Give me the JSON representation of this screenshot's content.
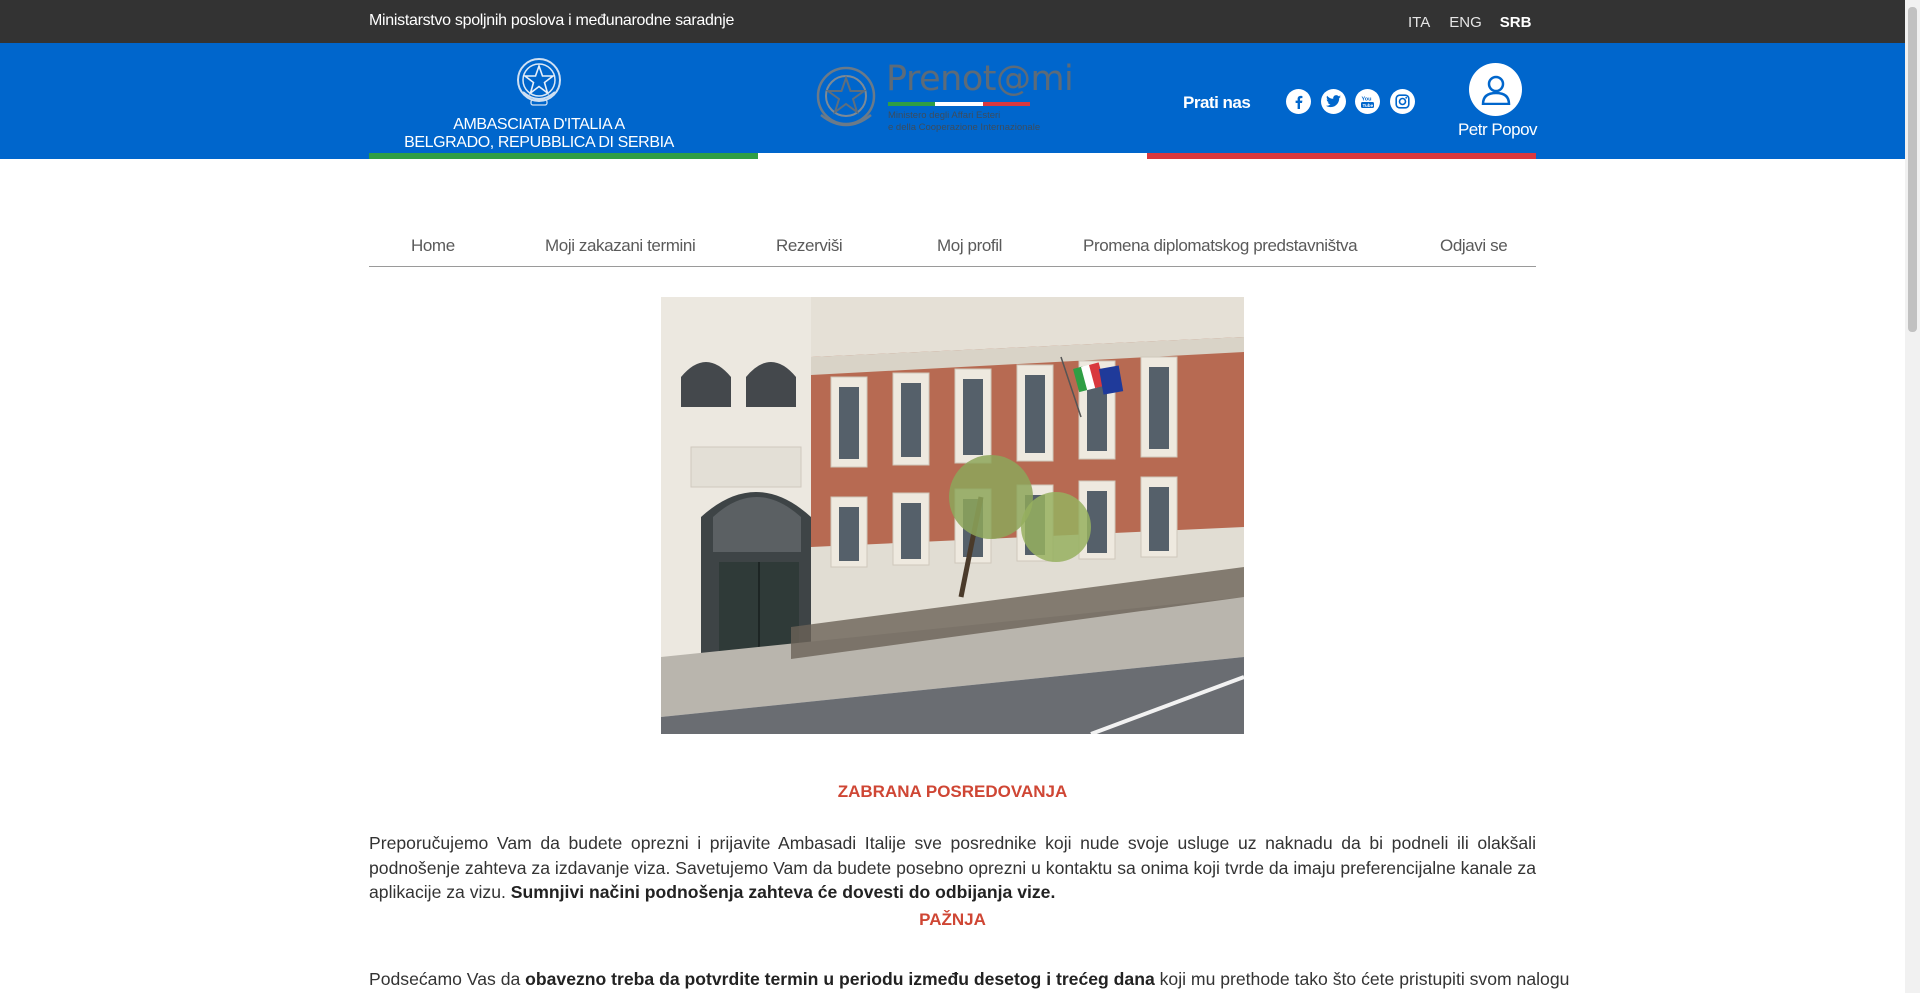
{
  "topbar": {
    "ministry": "Ministarstvo spoljnih poslova i međunarodne saradnje",
    "languages": [
      {
        "label": "ITA",
        "active": false
      },
      {
        "label": "ENG",
        "active": false
      },
      {
        "label": "SRB",
        "active": true
      }
    ]
  },
  "header": {
    "embassy_line1": "AMBASCIATA D'ITALIA A",
    "embassy_line2": "BELGRADO, REPUBBLICA DI SERBIA",
    "logo": {
      "word": "Prenot@mi",
      "sub1": "Ministero degli Affari Esteri",
      "sub2": "e della Cooperazione Internazionale"
    },
    "follow_label": "Prati nas",
    "social_icons": [
      "facebook-icon",
      "twitter-icon",
      "youtube-icon",
      "instagram-icon"
    ],
    "user_name": "Petr Popov",
    "colors": {
      "brand_blue": "#0066cc",
      "topbar": "#333333",
      "flag_green": "#2f9e44",
      "flag_white": "#ffffff",
      "flag_red": "#d9383e"
    }
  },
  "nav": {
    "items": [
      {
        "label": "Home"
      },
      {
        "label": "Moji zakazani termini"
      },
      {
        "label": "Rezerviši"
      },
      {
        "label": "Moj profil"
      },
      {
        "label": "Promena diplomatskog predstavništva"
      },
      {
        "label": "Odjavi se"
      }
    ]
  },
  "content": {
    "heading1": "ZABRANA POSREDOVANJA",
    "para1_text": "Preporučujemo Vam da budete oprezni i prijavite Ambasadi Italije sve posrednike koji nude svoje usluge uz naknadu da bi podneli ili olakšali podnošenje zahteva za izdavanje viza. Savetujemo Vam da budete posebno oprezni u kontaktu sa onima koji tvrde da imaju preferencijalne kanale za aplikacije za vizu.",
    "para1_bold": "Sumnjivi načini podnošenja zahteva će dovesti do odbijanja vize.",
    "heading2": "PAŽNJA",
    "para2_start": "Podsećamo Vas da",
    "para2_bold": "obavezno treba da potvrdite termin u periodu između desetog i trećeg dana",
    "para2_end": "koji mu prethode tako što ćete pristupiti svom nalogu"
  }
}
